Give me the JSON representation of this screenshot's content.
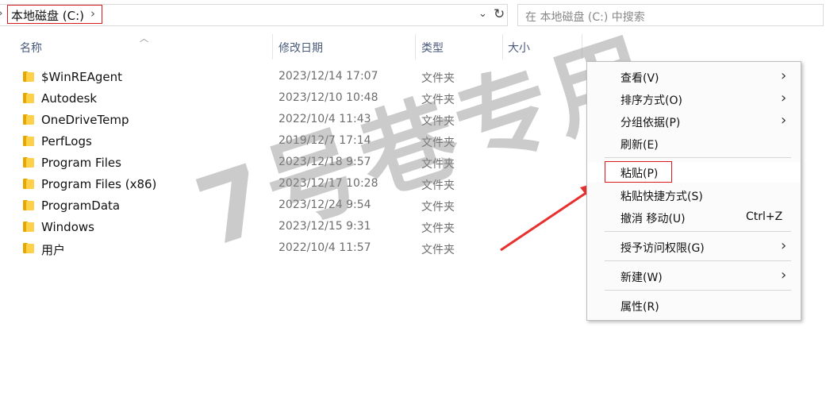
{
  "address": {
    "location": "本地磁盘 (C:)",
    "search_placeholder": "在 本地磁盘 (C:) 中搜索"
  },
  "columns": [
    "名称",
    "修改日期",
    "类型",
    "大小"
  ],
  "files": [
    {
      "name": "$WinREAgent",
      "date": "2023/12/14 17:07",
      "type": "文件夹"
    },
    {
      "name": "Autodesk",
      "date": "2023/12/10 10:48",
      "type": "文件夹"
    },
    {
      "name": "OneDriveTemp",
      "date": "2022/10/4 11:43",
      "type": "文件夹"
    },
    {
      "name": "PerfLogs",
      "date": "2019/12/7 17:14",
      "type": "文件夹"
    },
    {
      "name": "Program Files",
      "date": "2023/12/18 9:57",
      "type": "文件夹"
    },
    {
      "name": "Program Files (x86)",
      "date": "2023/12/17 10:28",
      "type": "文件夹"
    },
    {
      "name": "ProgramData",
      "date": "2023/12/24 9:54",
      "type": "文件夹"
    },
    {
      "name": "Windows",
      "date": "2023/12/15 9:31",
      "type": "文件夹"
    },
    {
      "name": "用户",
      "date": "2022/10/4 11:57",
      "type": "文件夹"
    }
  ],
  "context_menu": {
    "view": "查看(V)",
    "sort": "排序方式(O)",
    "group": "分组依据(P)",
    "refresh": "刷新(E)",
    "paste": "粘贴(P)",
    "paste_shortcut": "粘贴快捷方式(S)",
    "undo": "撤消 移动(U)",
    "undo_shortcut": "Ctrl+Z",
    "grant_access": "授予访问权限(G)",
    "new": "新建(W)",
    "properties": "属性(R)"
  },
  "watermark": "7号巷专用",
  "colors": {
    "highlight_border": "#e0181b",
    "arrow": "#e8312f",
    "folder": "#ffd04a"
  }
}
